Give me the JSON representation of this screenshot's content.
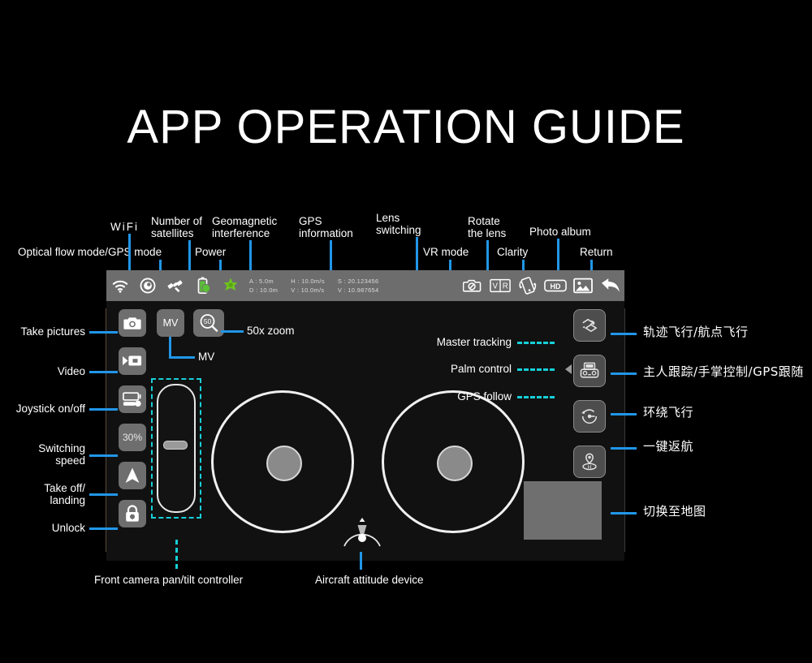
{
  "page": {
    "title": "APP OPERATION GUIDE",
    "background": "#000000",
    "accent": "#2196e8",
    "dash_accent": "#16d0d8"
  },
  "topbar": {
    "icons": [
      {
        "name": "wifi-icon",
        "label": "WiFi"
      },
      {
        "name": "optical-flow-icon",
        "label": "Optical flow mode/GPS mode"
      },
      {
        "name": "satellite-icon",
        "label": "Number of satellites"
      },
      {
        "name": "battery-icon",
        "label": "Power"
      },
      {
        "name": "geomagnetic-star-icon",
        "label": "Geomagnetic interference"
      }
    ],
    "telemetry": [
      {
        "top": "A : 5.0m",
        "bottom": "D : 10.0m"
      },
      {
        "top": "H : 10.0m/s",
        "bottom": "V : 10.0m/s"
      },
      {
        "top": "S : 20.123456",
        "bottom": "V : 10.987654"
      }
    ],
    "right_icons": [
      {
        "name": "lens-switch-icon",
        "label": "Lens switching"
      },
      {
        "name": "vr-mode-icon",
        "label": "VR mode",
        "text": "VR"
      },
      {
        "name": "rotate-lens-icon",
        "label": "Rotate the lens"
      },
      {
        "name": "clarity-hd-icon",
        "label": "Clarity",
        "text": "HD"
      },
      {
        "name": "photo-album-icon",
        "label": "Photo album"
      },
      {
        "name": "return-back-icon",
        "label": "Return"
      }
    ]
  },
  "top_labels": {
    "upper": [
      "WiFi",
      "Number of\nsatellites",
      "Geomagnetic\ninterference",
      "GPS\ninformation",
      "Lens\nswitching",
      "Rotate\nthe lens",
      "Photo album"
    ],
    "lower": [
      "Optical flow mode/GPS mode",
      "Power",
      "VR mode",
      "Clarity",
      "Return"
    ]
  },
  "left_controls": [
    {
      "name": "take-pictures-button",
      "label": "Take pictures",
      "icon": "camera-icon"
    },
    {
      "name": "video-button",
      "label": "Video",
      "icon": "video-camera-icon"
    },
    {
      "name": "joystick-toggle-button",
      "label": "Joystick on/off",
      "icon": "joystick-toggle-icon"
    },
    {
      "name": "switching-speed-button",
      "label": "Switching\nspeed",
      "icon": "speed-percent-icon",
      "value": "30%"
    },
    {
      "name": "takeoff-landing-button",
      "label": "Take off/\nlanding",
      "icon": "takeoff-arrow-icon"
    },
    {
      "name": "unlock-button",
      "label": "Unlock",
      "icon": "lock-icon"
    }
  ],
  "mv_row": {
    "mv_button": {
      "label": "MV",
      "callout": "MV"
    },
    "zoom_button": {
      "label": "50",
      "callout": "50x zoom"
    }
  },
  "center_labels": {
    "modes": [
      "Master tracking",
      "Palm control",
      "GPS follow"
    ],
    "pan_tilt": "Front camera pan/tilt controller",
    "attitude": "Aircraft attitude device"
  },
  "right_controls": [
    {
      "name": "waypoint-flight-button",
      "icon": "waypoint-flight-icon",
      "label": "轨迹飞行/航点飞行"
    },
    {
      "name": "follow-mode-button",
      "icon": "remote-controller-icon",
      "label": "主人跟踪/手掌控制/GPS跟随"
    },
    {
      "name": "orbit-flight-button",
      "icon": "orbit-icon",
      "label": "环绕飞行"
    },
    {
      "name": "return-home-button",
      "icon": "return-home-pin-icon",
      "label": "一键返航"
    },
    {
      "name": "map-switch-thumb",
      "icon": "map-thumbnail",
      "label": "切换至地图"
    }
  ]
}
